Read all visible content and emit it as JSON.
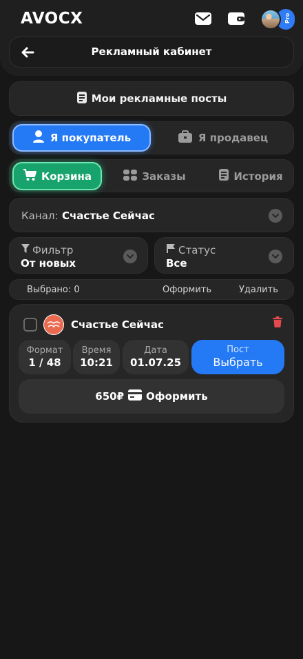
{
  "header": {
    "logo": "AVOCX",
    "pro_badge": "Pro",
    "icons": [
      "mail-icon",
      "wallet-icon",
      "avatar"
    ]
  },
  "title_bar": {
    "title": "Рекламный кабинет",
    "back_icon": "arrow-left-icon"
  },
  "my_posts_button": {
    "label": "Мои рекламные посты",
    "icon": "document-icon"
  },
  "role_switch": {
    "buyer": "Я покупатель",
    "seller": "Я продавец",
    "active": "buyer"
  },
  "tabs": {
    "cart": "Корзина",
    "orders": "Заказы",
    "history": "История",
    "active": "cart"
  },
  "channel_select": {
    "label": "Канал:",
    "value": "Счастье Сейчас"
  },
  "filter": {
    "label": "Фильтр",
    "value": "От новых"
  },
  "status": {
    "label": "Статус",
    "value": "Все"
  },
  "actions": {
    "selected": "Выбрано: 0",
    "checkout": "Оформить",
    "delete": "Удалить"
  },
  "order": {
    "channel_name": "Счастье Сейчас",
    "format_label": "Формат",
    "format_value": "1 / 48",
    "time_label": "Время",
    "time_value": "10:21",
    "date_label": "Дата",
    "date_value": "01.07.25",
    "post_label": "Пост",
    "post_value": "Выбрать",
    "price": "650₽",
    "checkout_label": "Оформить"
  },
  "colors": {
    "background": "#171717",
    "card": "#262626",
    "accent_blue": "#2479f4",
    "accent_green": "#17a36b",
    "danger": "#e5484d"
  }
}
